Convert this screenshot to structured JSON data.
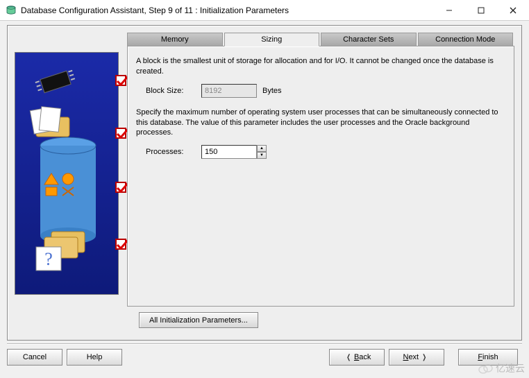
{
  "window": {
    "title": "Database Configuration Assistant, Step 9 of 11 : Initialization Parameters"
  },
  "tabs": {
    "memory": "Memory",
    "sizing": "Sizing",
    "charsets": "Character Sets",
    "connmode": "Connection Mode"
  },
  "sizing": {
    "block_desc": "A block is the smallest unit of storage for allocation and for I/O. It cannot be changed once the database is created.",
    "block_size_label": "Block Size:",
    "block_size_value": "8192",
    "block_size_unit": "Bytes",
    "processes_desc": "Specify the maximum number of operating system user processes that can be simultaneously connected to this database. The value of this parameter includes the user processes and the Oracle background processes.",
    "processes_label": "Processes:",
    "processes_value": "150"
  },
  "buttons": {
    "all_params": "All Initialization Parameters...",
    "cancel": "Cancel",
    "help": "Help",
    "back": "Back",
    "next": "Next",
    "finish": "Finish"
  },
  "watermark": "亿速云"
}
